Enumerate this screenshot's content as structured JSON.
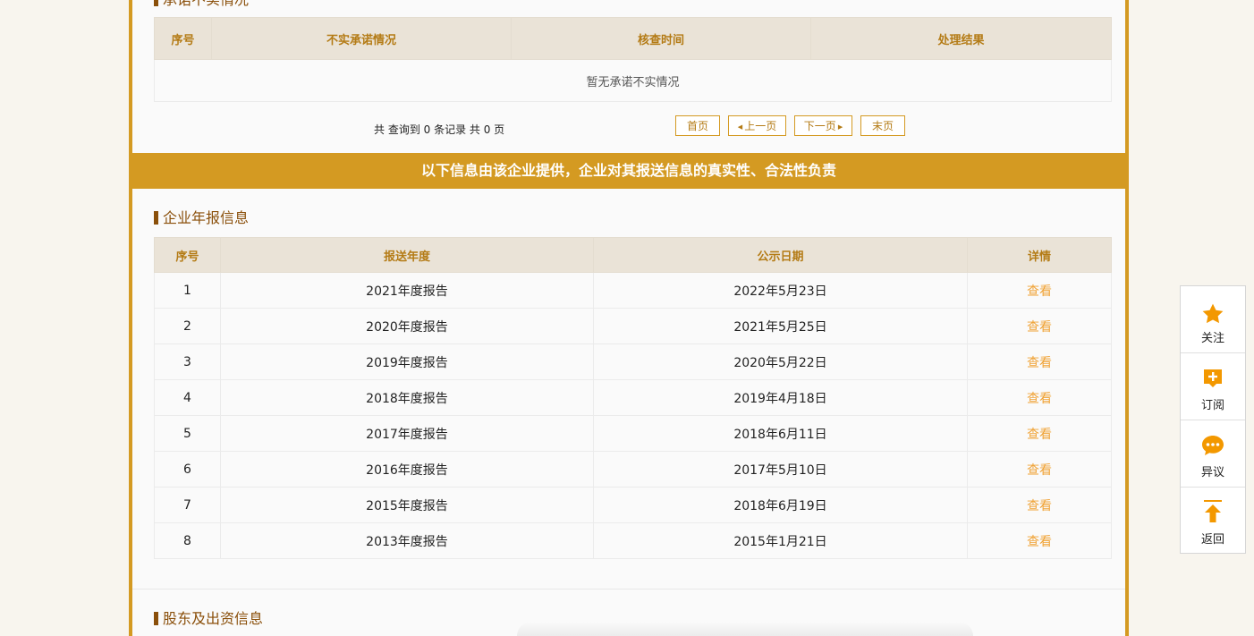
{
  "section1": {
    "title": "承诺不实情况",
    "headers": [
      "序号",
      "不实承诺情况",
      "核查时间",
      "处理结果"
    ],
    "empty_text": "暂无承诺不实情况",
    "pager": {
      "info": "共 查询到 0 条记录 共 0 页",
      "first": "首页",
      "prev": "上一页",
      "next": "下一页",
      "last": "末页"
    }
  },
  "banner": "以下信息由该企业提供，企业对其报送信息的真实性、合法性负责",
  "annual": {
    "title": "企业年报信息",
    "headers": [
      "序号",
      "报送年度",
      "公示日期",
      "详情"
    ],
    "rows": [
      {
        "no": "1",
        "year": "2021年度报告",
        "date": "2022年5月23日",
        "detail": "查看"
      },
      {
        "no": "2",
        "year": "2020年度报告",
        "date": "2021年5月25日",
        "detail": "查看"
      },
      {
        "no": "3",
        "year": "2019年度报告",
        "date": "2020年5月22日",
        "detail": "查看"
      },
      {
        "no": "4",
        "year": "2018年度报告",
        "date": "2019年4月18日",
        "detail": "查看"
      },
      {
        "no": "5",
        "year": "2017年度报告",
        "date": "2018年6月11日",
        "detail": "查看"
      },
      {
        "no": "6",
        "year": "2016年度报告",
        "date": "2017年5月10日",
        "detail": "查看"
      },
      {
        "no": "7",
        "year": "2015年度报告",
        "date": "2018年6月19日",
        "detail": "查看"
      },
      {
        "no": "8",
        "year": "2013年度报告",
        "date": "2015年1月21日",
        "detail": "查看"
      }
    ]
  },
  "shareholder": {
    "title": "股东及出资信息"
  },
  "sidebar": {
    "follow": "关注",
    "subscribe": "订阅",
    "objection": "异议",
    "back": "返回"
  },
  "colors": {
    "accent": "#d49a22",
    "title": "#8a4f0a",
    "link": "#f0a234"
  }
}
